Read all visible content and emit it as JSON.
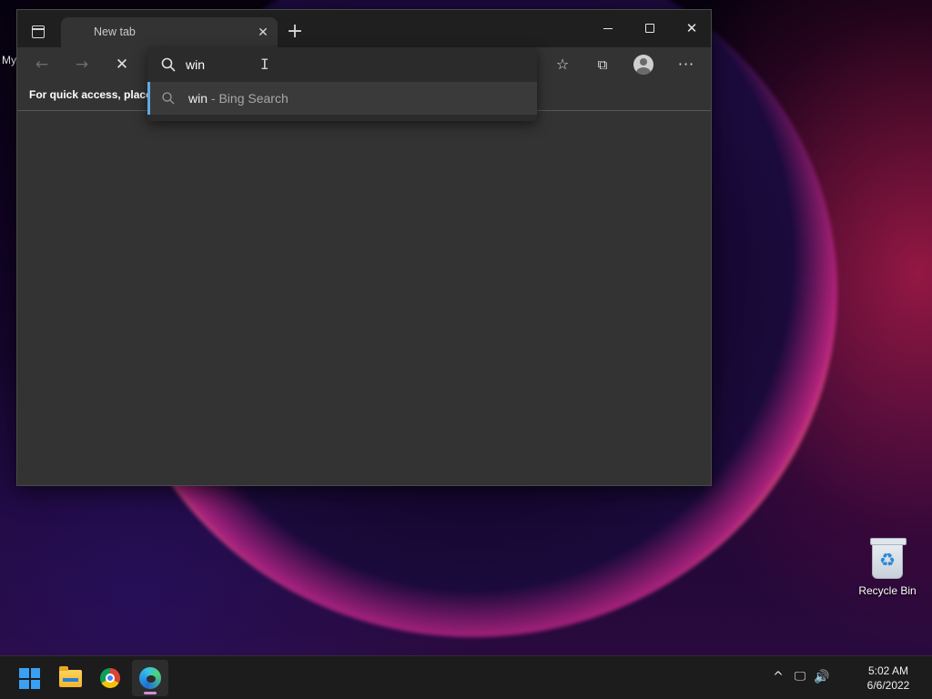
{
  "desktop": {
    "partial_label": "My",
    "icons": [
      {
        "label": "Recycle Bin"
      }
    ]
  },
  "browser": {
    "tab": {
      "title": "New tab"
    },
    "address_bar": {
      "value": "win",
      "suggestions": [
        {
          "query": "win",
          "separator": "-",
          "provider": "Bing Search"
        }
      ]
    },
    "favorites_bar_text": "For quick access, place your favorites here on the favorites bar."
  },
  "icons": {
    "tab_actions": "tab-actions-icon",
    "close_tab": "close-icon",
    "new_tab": "plus-icon",
    "minimize": "minimize-icon",
    "maximize": "maximize-icon",
    "close_window": "close-icon",
    "back": "arrow-left-icon",
    "forward": "arrow-right-icon",
    "stop": "close-icon",
    "favorites": "star-list-icon",
    "collections": "collections-icon",
    "profile": "profile-icon",
    "more": "more-icon",
    "search": "search-icon"
  },
  "glyphs": {
    "close": "✕",
    "plus": "+",
    "back": "←",
    "forward": "→",
    "favorites": "☆",
    "collections": "⧉",
    "more": "···",
    "cursor": "I",
    "chevron_up": "^",
    "network": "🖵",
    "volume": "🔊"
  },
  "taskbar": {
    "apps": [
      "Start",
      "File Explorer",
      "Google Chrome",
      "Microsoft Edge"
    ],
    "clock": {
      "time": "5:02 AM",
      "date": "6/6/2022"
    }
  },
  "colors": {
    "accent_blue": "#5fa8e6",
    "window_bg": "#333333",
    "titlebar_bg": "#1f1f1f",
    "taskbar_bg": "#1c1c1c",
    "edge_indicator": "#d88ed2"
  }
}
